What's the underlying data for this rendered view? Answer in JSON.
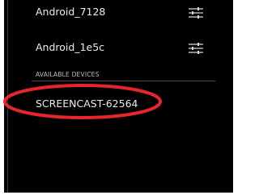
{
  "devices_list": {
    "paired": [
      {
        "name": "Android_7128",
        "settings_icon": "sliders-icon"
      },
      {
        "name": "Android_1e5c",
        "settings_icon": "sliders-icon"
      }
    ],
    "available_header": "AVAILABLE DEVICES",
    "available": [
      {
        "name": "SCREENCAST-62564"
      }
    ]
  },
  "colors": {
    "background": "#000000",
    "text": "#ececec",
    "header_text": "#bfbfbf",
    "divider": "#4a4a4a",
    "highlight": "#e8242c"
  }
}
